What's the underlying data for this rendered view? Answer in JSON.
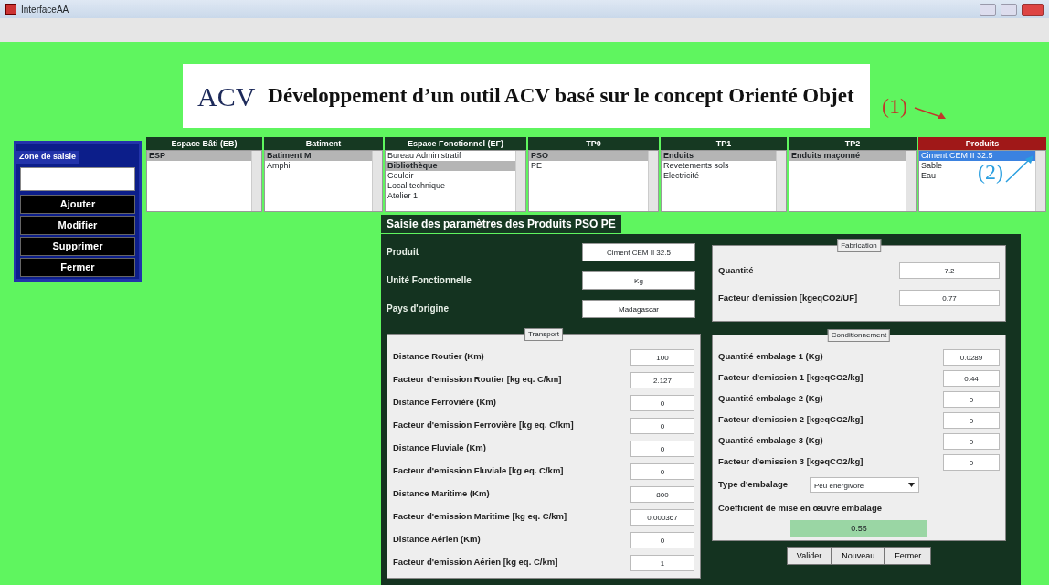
{
  "window": {
    "title": "InterfaceAA"
  },
  "banner": {
    "logo_text": "ACV",
    "title": "Développement d’un outil ACV basé sur le concept Orienté Objet"
  },
  "entry_panel": {
    "title": "Zone de saisie",
    "buttons": [
      "Ajouter",
      "Modifier",
      "Supprimer",
      "Fermer"
    ]
  },
  "lists": [
    {
      "header": "Espace Bâti (EB)",
      "active": false,
      "items": [
        {
          "label": "ESP",
          "selected": true
        }
      ]
    },
    {
      "header": "Batiment",
      "active": false,
      "items": [
        {
          "label": "Batiment M",
          "selected": true
        },
        {
          "label": "Amphi",
          "selected": false
        }
      ]
    },
    {
      "header": "Espace Fonctionnel (EF)",
      "active": false,
      "items": [
        {
          "label": "Bureau Administratif",
          "selected": false
        },
        {
          "label": "Bibliothèque",
          "selected": true
        },
        {
          "label": "Couloir",
          "selected": false
        },
        {
          "label": "Local technique",
          "selected": false
        },
        {
          "label": "Atelier 1",
          "selected": false
        }
      ]
    },
    {
      "header": "TP0",
      "active": false,
      "items": [
        {
          "label": "PSO",
          "selected": true
        },
        {
          "label": "PE",
          "selected": false
        }
      ]
    },
    {
      "header": "TP1",
      "active": false,
      "items": [
        {
          "label": "Enduits",
          "selected": true
        },
        {
          "label": "Revetements sols",
          "selected": false
        },
        {
          "label": "Electricité",
          "selected": false
        }
      ]
    },
    {
      "header": "TP2",
      "active": false,
      "items": [
        {
          "label": "Enduits maçonné",
          "selected": true
        }
      ]
    },
    {
      "header": "Produits",
      "active": true,
      "items": [
        {
          "label": "Ciment CEM II 32.5",
          "selected": true
        },
        {
          "label": "Sable",
          "selected": false
        },
        {
          "label": "Eau",
          "selected": false
        }
      ]
    }
  ],
  "annotations": [
    {
      "text": "(1)",
      "color": "#c0392b"
    },
    {
      "text": "(2)",
      "color": "#2a9fe0"
    }
  ],
  "dialog": {
    "title": "Saisie des paramètres des Produits PSO PE",
    "fields": [
      {
        "label": "Produit",
        "value": "Ciment CEM II 32.5"
      },
      {
        "label": "Unité Fonctionnelle",
        "value": "Kg"
      },
      {
        "label": "Pays d'origine",
        "value": "Madagascar"
      }
    ],
    "transport": {
      "title": "Transport",
      "rows": [
        {
          "label": "Distance Routier (Km)",
          "value": "100"
        },
        {
          "label": "Facteur d'emission Routier [kg eq. C/km]",
          "value": "2.127"
        },
        {
          "label": "Distance Ferrovière (Km)",
          "value": "0"
        },
        {
          "label": "Facteur d'emission Ferrovière [kg eq. C/km]",
          "value": "0"
        },
        {
          "label": "Distance Fluviale (Km)",
          "value": "0"
        },
        {
          "label": "Facteur d'emission Fluviale [kg eq. C/km]",
          "value": "0"
        },
        {
          "label": "Distance Maritime (Km)",
          "value": "800"
        },
        {
          "label": "Facteur d'emission Maritime [kg eq. C/km]",
          "value": "0.000367"
        },
        {
          "label": "Distance Aérien (Km)",
          "value": "0"
        },
        {
          "label": "Facteur d'emission Aérien [kg eq. C/km]",
          "value": "1"
        }
      ]
    },
    "fabrication": {
      "title": "Fabrication",
      "rows": [
        {
          "label": "Quantité",
          "value": "7.2"
        },
        {
          "label": "Facteur d'emission  [kgeqCO2/UF]",
          "value": "0.77"
        }
      ]
    },
    "conditionnement": {
      "title": "Conditionnement",
      "rows": [
        {
          "label": "Quantité embalage 1 (Kg)",
          "value": "0.0289"
        },
        {
          "label": "Facteur d'emission 1 [kgeqCO2/kg]",
          "value": "0.44"
        },
        {
          "label": "Quantité embalage 2 (Kg)",
          "value": "0"
        },
        {
          "label": "Facteur d'emission 2  [kgeqCO2/kg]",
          "value": "0"
        },
        {
          "label": "Quantité embalage 3 (Kg)",
          "value": "0"
        },
        {
          "label": "Facteur d'emission 3 [kgeqCO2/kg]",
          "value": "0"
        }
      ],
      "type_label": "Type d'embalage",
      "type_value": "Peu énergivore",
      "coef_label": "Coefficient de mise en œuvre embalage",
      "coef_value": "0.55"
    },
    "buttons": [
      "Valider",
      "Nouveau",
      "Fermer"
    ]
  }
}
